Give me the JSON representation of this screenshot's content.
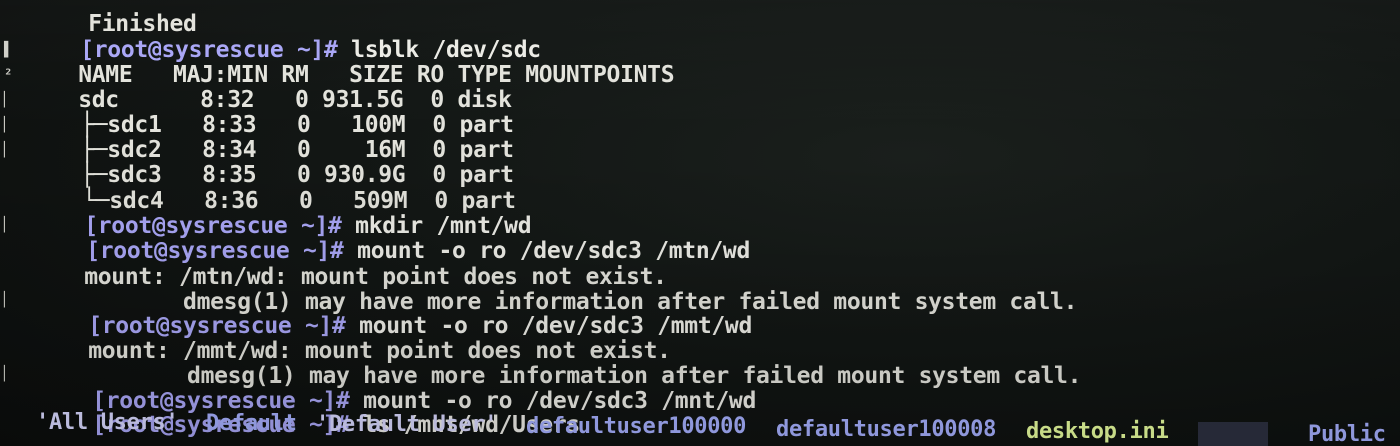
{
  "terminal": {
    "lines": [
      {
        "prompt": "",
        "text": "Finished"
      },
      {
        "prompt": "[root@sysrescue ~]# ",
        "text": "lsblk /dev/sdc"
      },
      {
        "prompt": "",
        "text": "NAME   MAJ:MIN RM   SIZE RO TYPE MOUNTPOINTS"
      },
      {
        "prompt": "",
        "text": "sdc      8:32   0 931.5G  0 disk"
      },
      {
        "prompt": "",
        "text": "├─sdc1   8:33   0   100M  0 part"
      },
      {
        "prompt": "",
        "text": "├─sdc2   8:34   0    16M  0 part"
      },
      {
        "prompt": "",
        "text": "├─sdc3   8:35   0 930.9G  0 part"
      },
      {
        "prompt": "",
        "text": "└─sdc4   8:36   0   509M  0 part"
      },
      {
        "prompt": "[root@sysrescue ~]# ",
        "text": "mkdir /mnt/wd"
      },
      {
        "prompt": "[root@sysrescue ~]# ",
        "text": "mount -o ro /dev/sdc3 /mtn/wd"
      },
      {
        "prompt": "",
        "text": "mount: /mtn/wd: mount point does not exist."
      },
      {
        "prompt": "",
        "text": "       dmesg(1) may have more information after failed mount system call."
      },
      {
        "prompt": "[root@sysrescue ~]# ",
        "text": "mount -o ro /dev/sdc3 /mmt/wd"
      },
      {
        "prompt": "",
        "text": "mount: /mmt/wd: mount point does not exist."
      },
      {
        "prompt": "",
        "text": "       dmesg(1) may have more information after failed mount system call."
      },
      {
        "prompt": "[root@sysrescue ~]# ",
        "text": "mount -o ro /dev/sdc3 /mnt/wd"
      },
      {
        "prompt": "[root@sysrescue ~]# ",
        "text": "ls /mnt/wd/Users"
      }
    ],
    "ls_output": [
      {
        "text": "'All Users'",
        "kind": "quoted"
      },
      {
        "text": "Default",
        "kind": "dir"
      },
      {
        "text": "'Default User'",
        "kind": "quoted"
      },
      {
        "text": "defaultuser100000",
        "kind": "dir"
      },
      {
        "text": "defaultuser100008",
        "kind": "dir"
      },
      {
        "text": "desktop.ini",
        "kind": "file"
      },
      {
        "text": "Public",
        "kind": "dir"
      }
    ],
    "colors": {
      "prompt": "#a9a6f6",
      "text": "#ecece6",
      "directory": "#a6b0ff",
      "file": "#e8ff9e",
      "background": "#121614"
    }
  }
}
